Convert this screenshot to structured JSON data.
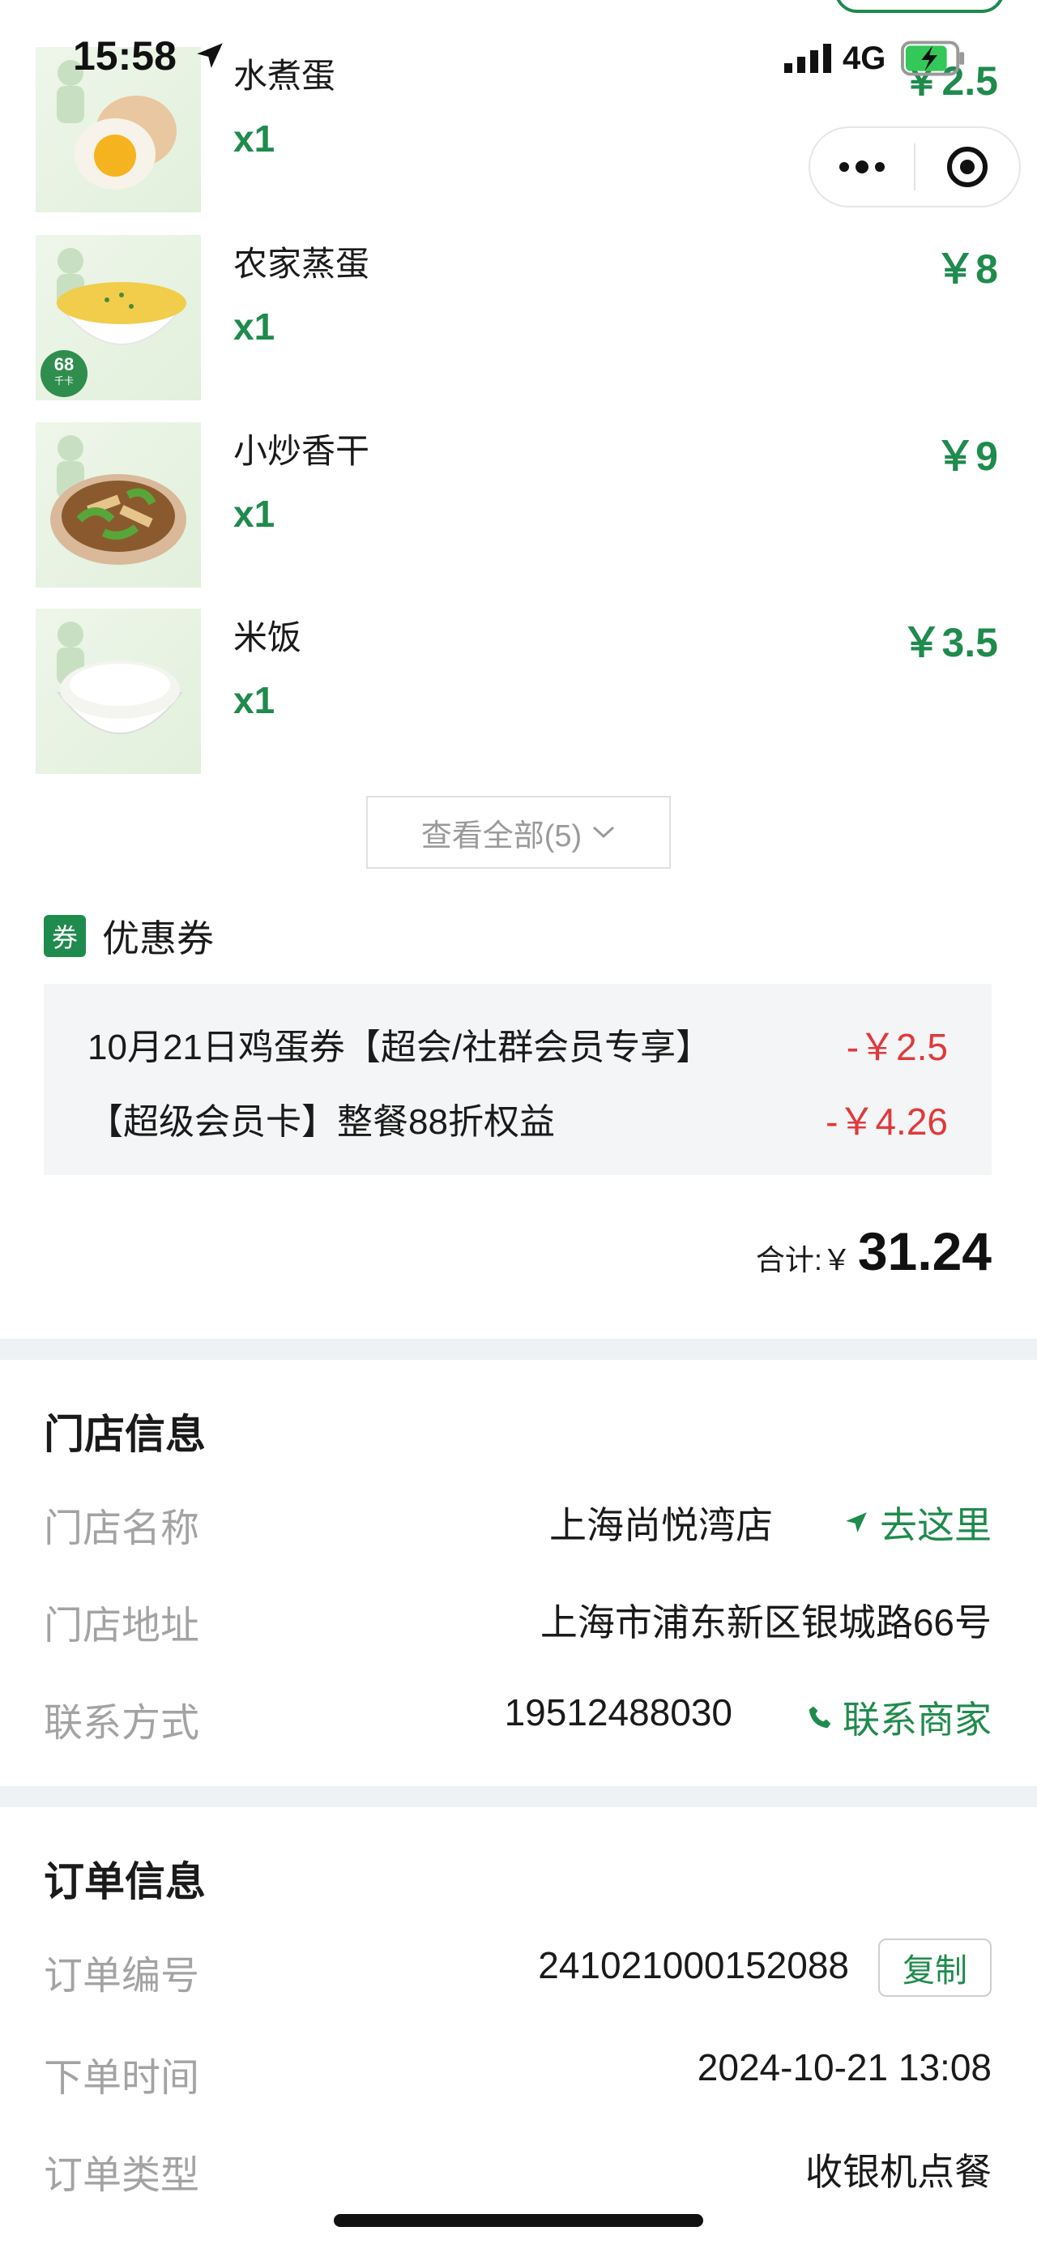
{
  "status_bar": {
    "time": "15:58",
    "network": "4G"
  },
  "items": [
    {
      "name": "水煮蛋",
      "qty": "x1",
      "price": "￥2.5"
    },
    {
      "name": "农家蒸蛋",
      "qty": "x1",
      "price": "￥8",
      "badge": "68",
      "badge_unit": "千卡"
    },
    {
      "name": "小炒香干",
      "qty": "x1",
      "price": "￥9"
    },
    {
      "name": "米饭",
      "qty": "x1",
      "price": "￥3.5"
    }
  ],
  "view_all": {
    "label": "查看全部(5)"
  },
  "coupons": {
    "title": "优惠券",
    "icon_text": "券",
    "list": [
      {
        "name": "10月21日鸡蛋券【超会/社群会员专享】",
        "amount": "-￥2.5"
      },
      {
        "name": "【超级会员卡】整餐88折权益",
        "amount": "-￥4.26"
      }
    ]
  },
  "total": {
    "label": "合计:￥",
    "value": "31.24"
  },
  "store_info": {
    "title": "门店信息",
    "rows": [
      {
        "label": "门店名称",
        "value": "上海尚悦湾店",
        "action": "去这里"
      },
      {
        "label": "门店地址",
        "value": "上海市浦东新区银城路66号"
      },
      {
        "label": "联系方式",
        "value": "19512488030",
        "action": "联系商家"
      }
    ]
  },
  "order_info": {
    "title": "订单信息",
    "rows": [
      {
        "label": "订单编号",
        "value": "241021000152088",
        "action": "复制"
      },
      {
        "label": "下单时间",
        "value": "2024-10-21 13:08"
      },
      {
        "label": "订单类型",
        "value": "收银机点餐"
      }
    ]
  },
  "colors": {
    "accent": "#1f8b4c",
    "discount": "#e0393b",
    "muted": "#a3a3a3",
    "divider": "#eef2f4"
  },
  "icons": [
    "location-arrow-icon",
    "signal-icon",
    "battery-icon",
    "more-icon",
    "close-target-icon",
    "chevron-down-icon",
    "navigate-icon",
    "phone-icon"
  ]
}
